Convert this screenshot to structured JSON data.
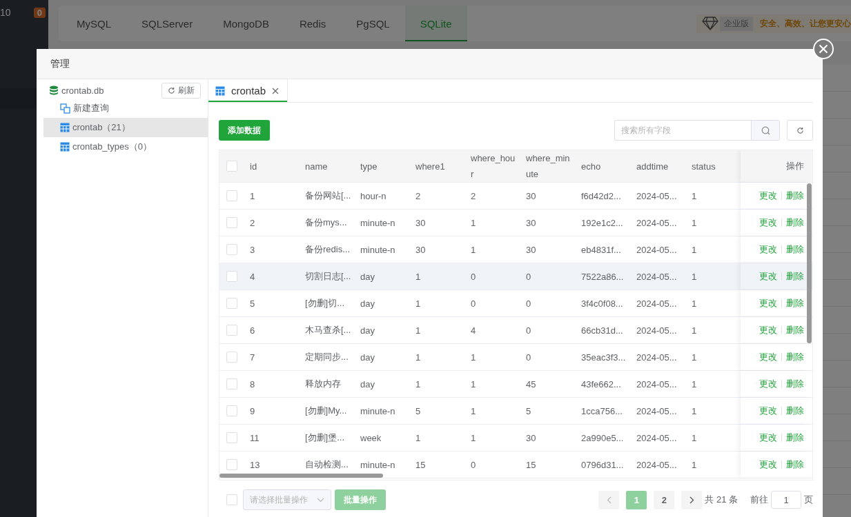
{
  "left_nav": {
    "count": "10",
    "badge": "0"
  },
  "db_tabs": [
    {
      "label": "MySQL",
      "selected": false
    },
    {
      "label": "SQLServer",
      "selected": false
    },
    {
      "label": "MongoDB",
      "selected": false
    },
    {
      "label": "Redis",
      "selected": false
    },
    {
      "label": "PgSQL",
      "selected": false
    },
    {
      "label": "SQLite",
      "selected": true
    }
  ],
  "promo": {
    "badge": "企业版",
    "text": "安全、高效、让您更安心"
  },
  "modal": {
    "title": "管理",
    "tree": {
      "database": "crontab.db",
      "refresh": "刷新",
      "items": [
        {
          "kind": "query",
          "label": "新建查询",
          "selected": false
        },
        {
          "kind": "table",
          "label": "crontab",
          "count": "（21）",
          "selected": true
        },
        {
          "kind": "table",
          "label": "crontab_types",
          "count": "（0）",
          "selected": false
        }
      ]
    },
    "editor_tabs": [
      {
        "label": "crontab",
        "selected": true
      }
    ],
    "add_button": "添加数据",
    "search": {
      "placeholder": "搜索所有字段"
    },
    "table": {
      "header_checked": false,
      "columns": [
        "id",
        "name",
        "type",
        "where1",
        "where_hour",
        "where_minute",
        "echo",
        "addtime",
        "status"
      ],
      "actions_header": "操作",
      "rows": [
        {
          "checked": false,
          "highlighted": false,
          "cells": [
            "1",
            "备份网站[...",
            "hour-n",
            "2",
            "2",
            "30",
            "f6d42d2...",
            "2024-05...",
            "1"
          ],
          "actions": [
            "更改",
            "删除"
          ]
        },
        {
          "checked": false,
          "highlighted": false,
          "cells": [
            "2",
            "备份mys...",
            "minute-n",
            "30",
            "1",
            "30",
            "192e1c2...",
            "2024-05...",
            "1"
          ],
          "actions": [
            "更改",
            "删除"
          ]
        },
        {
          "checked": false,
          "highlighted": false,
          "cells": [
            "3",
            "备份redis...",
            "minute-n",
            "30",
            "1",
            "30",
            "eb4831f...",
            "2024-05...",
            "1"
          ],
          "actions": [
            "更改",
            "删除"
          ]
        },
        {
          "checked": false,
          "highlighted": true,
          "cells": [
            "4",
            "切割日志[...",
            "day",
            "1",
            "0",
            "0",
            "7522a86...",
            "2024-05...",
            "1"
          ],
          "actions": [
            "更改",
            "删除"
          ]
        },
        {
          "checked": false,
          "highlighted": false,
          "cells": [
            "5",
            "[勿删]切...",
            "day",
            "1",
            "0",
            "0",
            "3f4c0f08...",
            "2024-05...",
            "1"
          ],
          "actions": [
            "更改",
            "删除"
          ]
        },
        {
          "checked": false,
          "highlighted": false,
          "cells": [
            "6",
            "木马查杀[...",
            "day",
            "1",
            "4",
            "0",
            "66cb31d...",
            "2024-05...",
            "1"
          ],
          "actions": [
            "更改",
            "删除"
          ]
        },
        {
          "checked": false,
          "highlighted": false,
          "cells": [
            "7",
            "定期同步...",
            "day",
            "1",
            "1",
            "0",
            "35eac3f3...",
            "2024-05...",
            "1"
          ],
          "actions": [
            "更改",
            "删除"
          ]
        },
        {
          "checked": false,
          "highlighted": false,
          "cells": [
            "8",
            "释放内存",
            "day",
            "1",
            "1",
            "45",
            "43fe662...",
            "2024-05...",
            "1"
          ],
          "actions": [
            "更改",
            "删除"
          ]
        },
        {
          "checked": false,
          "highlighted": false,
          "cells": [
            "9",
            "[勿删]My...",
            "minute-n",
            "5",
            "1",
            "5",
            "1cca756...",
            "2024-05...",
            "1"
          ],
          "actions": [
            "更改",
            "删除"
          ]
        },
        {
          "checked": false,
          "highlighted": false,
          "cells": [
            "11",
            "[勿删]堡...",
            "week",
            "1",
            "1",
            "30",
            "2a990e5...",
            "2024-05...",
            "1"
          ],
          "actions": [
            "更改",
            "删除"
          ]
        },
        {
          "checked": false,
          "highlighted": false,
          "cells": [
            "13",
            "自动检测...",
            "minute-n",
            "15",
            "0",
            "15",
            "0796d31...",
            "2024-05...",
            "1"
          ],
          "actions": [
            "更改",
            "删除"
          ]
        }
      ]
    },
    "footer": {
      "checked": false,
      "bulk_select": {
        "placeholder": "请选择批量操作"
      },
      "bulk_button": {
        "label": "批量操作",
        "disabled": true
      },
      "pages": [
        {
          "label": "1",
          "selected": true
        },
        {
          "label": "2",
          "selected": false
        }
      ],
      "total": "共 21 条",
      "goto": "前往",
      "page_input": "1",
      "page_suffix": "页"
    }
  }
}
